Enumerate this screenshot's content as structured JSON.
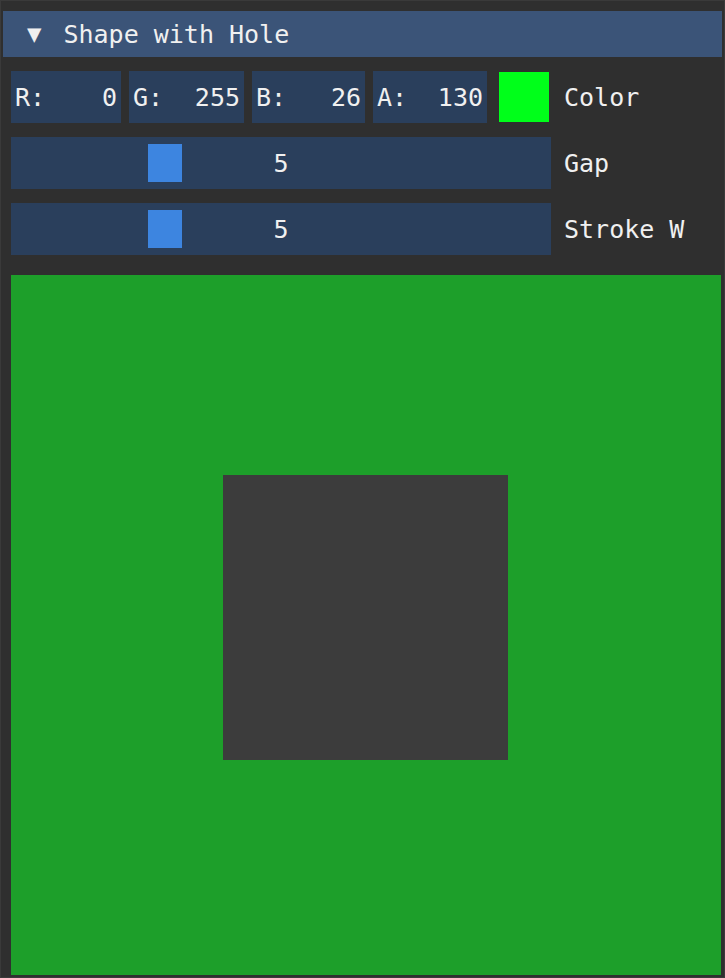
{
  "window": {
    "title": "Shape with Hole",
    "collapse_arrow": "▼",
    "expanded": true
  },
  "color_edit": {
    "label": "Color",
    "swatch": "#00ff1a",
    "fields": [
      {
        "label": "R:",
        "value": "0"
      },
      {
        "label": "G:",
        "value": "255"
      },
      {
        "label": "B:",
        "value": "26"
      },
      {
        "label": "A:",
        "value": "130"
      }
    ]
  },
  "sliders": [
    {
      "label": "Gap",
      "value": "5",
      "level": 0.27
    },
    {
      "label": "Stroke W",
      "value": "5",
      "level": 0.27
    }
  ]
}
